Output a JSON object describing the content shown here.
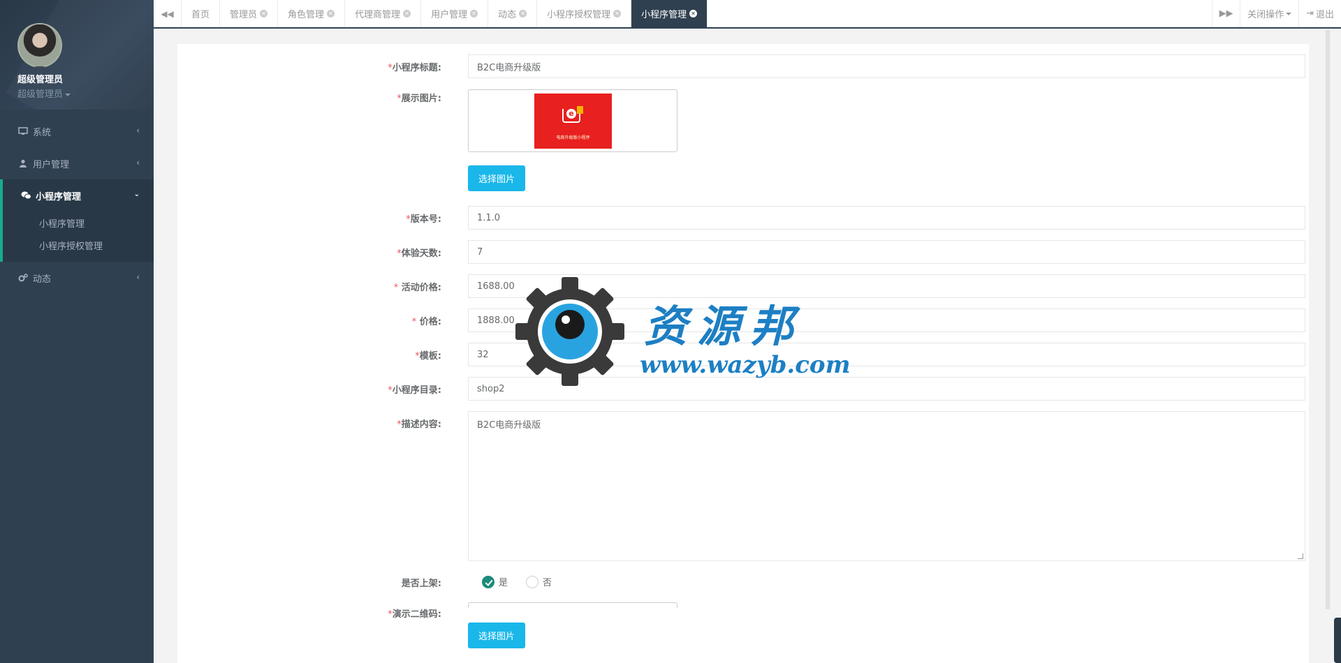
{
  "sidebar": {
    "profile": {
      "name": "超级管理员",
      "role": "超级管理员"
    },
    "nav": [
      {
        "label": "系统",
        "icon": "monitor-icon"
      },
      {
        "label": "用户管理",
        "icon": "user-icon"
      },
      {
        "label": "小程序管理",
        "icon": "wechat-icon",
        "children": [
          "小程序管理",
          "小程序授权管理"
        ]
      },
      {
        "label": "动态",
        "icon": "gears-icon"
      }
    ]
  },
  "tabbar": {
    "tabs": [
      {
        "label": "首页",
        "closable": false
      },
      {
        "label": "管理员",
        "closable": true
      },
      {
        "label": "角色管理",
        "closable": true
      },
      {
        "label": "代理商管理",
        "closable": true
      },
      {
        "label": "用户管理",
        "closable": true
      },
      {
        "label": "动态",
        "closable": true
      },
      {
        "label": "小程序授权管理",
        "closable": true
      },
      {
        "label": "小程序管理",
        "closable": true,
        "active": true
      }
    ],
    "close_ops": "关闭操作",
    "logout": "退出"
  },
  "form": {
    "title_label": "小程序标题:",
    "title_value": "B2C电商升级版",
    "image_label": "展示图片:",
    "image_caption": "电商升级版小程序",
    "choose_image": "选择图片",
    "version_label": "版本号:",
    "version_value": "1.1.0",
    "trial_days_label": "体验天数:",
    "trial_days_value": "7",
    "promo_price_label": " 活动价格:",
    "promo_price_value": "1688.00",
    "price_label": " 价格:",
    "price_value": "1888.00",
    "template_label": "模板:",
    "template_value": "32",
    "dir_label": "小程序目录:",
    "dir_value": "shop2",
    "desc_label": "描述内容:",
    "desc_value": "B2C电商升级版",
    "listed_label": "是否上架:",
    "listed_yes": "是",
    "listed_no": "否",
    "qr_label": "演示二维码:",
    "choose_qr": "选择图片"
  },
  "watermark": {
    "title": "资源邦",
    "url": "www.wazyb.com"
  },
  "colors": {
    "sidebar_bg": "#2f4050",
    "accent": "#19aa8d",
    "button": "#1ab7ea",
    "required": "#ed5565"
  }
}
